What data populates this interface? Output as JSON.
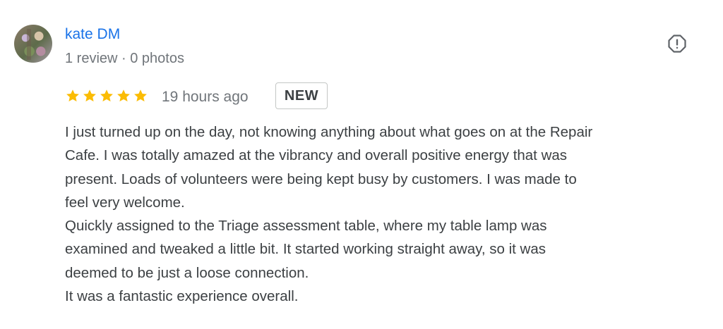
{
  "review": {
    "author": "kate DM",
    "meta": "1 review · 0 photos",
    "rating": 5,
    "max_rating": 5,
    "time": "19 hours ago",
    "badge": "NEW",
    "lines": [
      "I just turned up on the day, not knowing anything about what goes on at the Repair",
      "Cafe. I was totally amazed at the vibrancy and overall positive energy that was",
      "present. Loads of volunteers were being kept busy by customers. I was made to",
      "feel very welcome.",
      "Quickly assigned to the Triage assessment table, where my table lamp was",
      "examined and tweaked a little bit. It started working straight away, so it was",
      "deemed to be just a loose connection.",
      "It was a fantastic experience overall."
    ]
  },
  "icons": {
    "star": "star-icon",
    "flag": "report-flag-icon"
  },
  "colors": {
    "author_link": "#1a73e8",
    "secondary_text": "#70757a",
    "body_text": "#3c4043",
    "star": "#fbbc04",
    "badge_border": "#c4c7c5"
  }
}
